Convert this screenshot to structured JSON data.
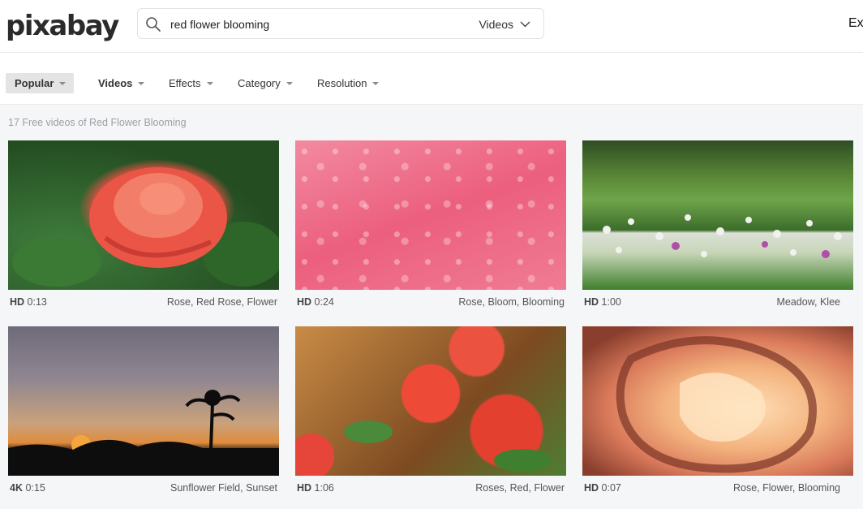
{
  "header": {
    "logo": "pixabay",
    "search": {
      "value": "red flower blooming",
      "type_label": "Videos"
    },
    "explore_label": "Ex"
  },
  "filters": [
    {
      "label": "Popular"
    },
    {
      "label": "Videos"
    },
    {
      "label": "Effects"
    },
    {
      "label": "Category"
    },
    {
      "label": "Resolution"
    }
  ],
  "results_count": "17 Free videos of Red Flower Blooming",
  "videos": [
    {
      "quality": "HD",
      "duration": "0:13",
      "tags": "Rose, Red Rose, Flower"
    },
    {
      "quality": "HD",
      "duration": "0:24",
      "tags": "Rose, Bloom, Blooming"
    },
    {
      "quality": "HD",
      "duration": "1:00",
      "tags": "Meadow, Klee"
    },
    {
      "quality": "4K",
      "duration": "0:15",
      "tags": "Sunflower Field, Sunset"
    },
    {
      "quality": "HD",
      "duration": "1:06",
      "tags": "Roses, Red, Flower"
    },
    {
      "quality": "HD",
      "duration": "0:07",
      "tags": "Rose, Flower, Blooming"
    }
  ]
}
